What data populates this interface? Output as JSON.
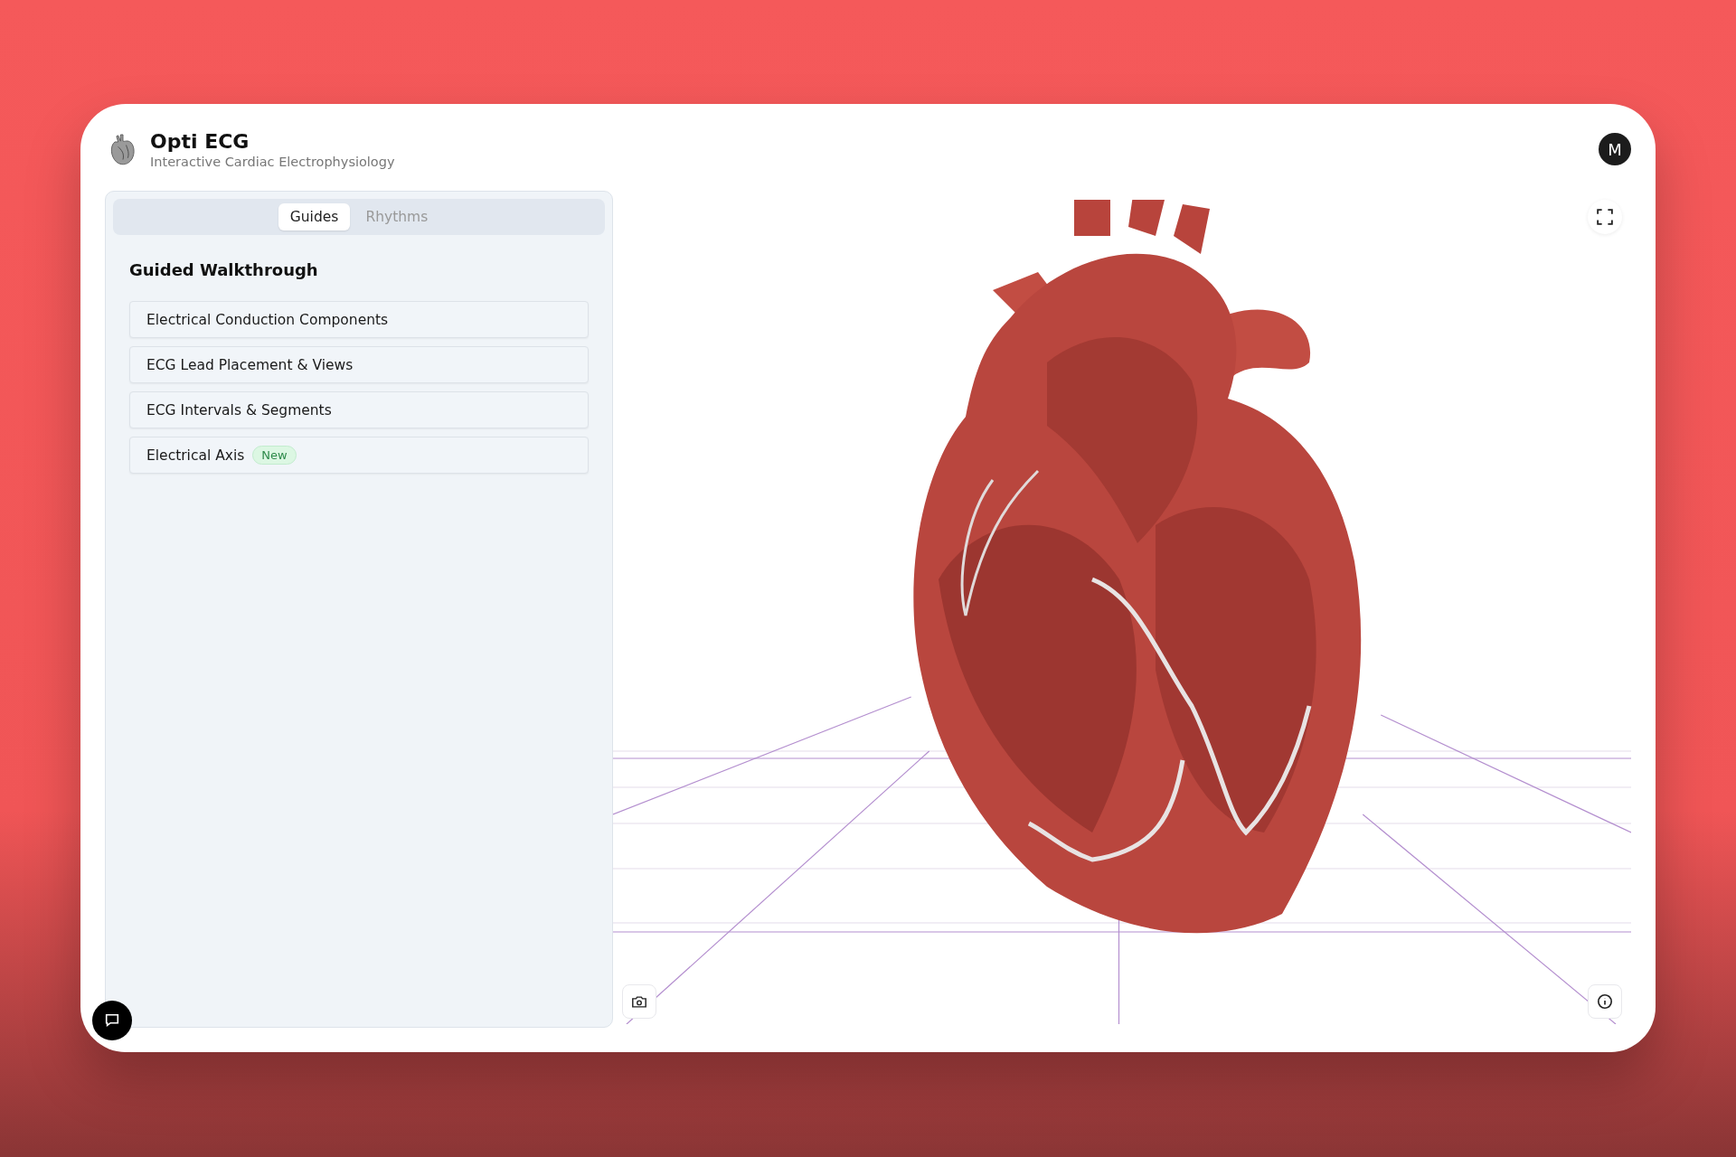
{
  "app": {
    "title": "Opti ECG",
    "subtitle": "Interactive Cardiac Electrophysiology",
    "avatar_initial": "M"
  },
  "tabs": [
    {
      "label": "Guides",
      "selected": true
    },
    {
      "label": "Rhythms",
      "selected": false
    }
  ],
  "section_title": "Guided Walkthrough",
  "guides": [
    {
      "label": "Electrical Conduction Components"
    },
    {
      "label": "ECG Lead Placement & Views"
    },
    {
      "label": "ECG Intervals & Segments"
    },
    {
      "label": "Electrical Axis",
      "badge": "New"
    }
  ]
}
